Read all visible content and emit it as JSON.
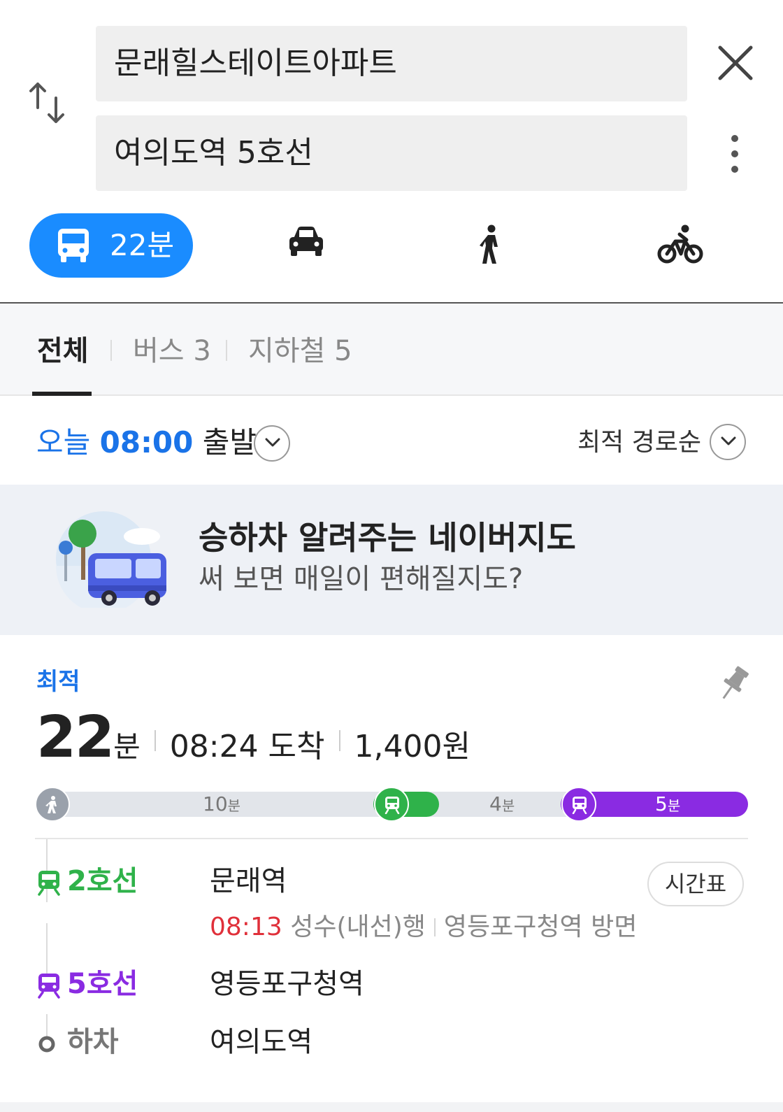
{
  "search": {
    "origin": "문래힐스테이트아파트",
    "destination": "여의도역 5호선"
  },
  "modes": {
    "transit_time": "22분",
    "active_color": "#1a8cff",
    "icons": [
      "bus-icon",
      "car-icon",
      "walk-icon",
      "bike-icon"
    ]
  },
  "tabs": {
    "all": "전체",
    "bus": "버스 3",
    "subway": "지하철 5"
  },
  "depart": {
    "today": "오늘",
    "time": "08:00",
    "label": "출발",
    "sort": "최적 경로순"
  },
  "banner": {
    "title": "승하차 알려주는 네이버지도",
    "subtitle": "써 보면 매일이 편해질지도?"
  },
  "route": {
    "badge": "최적",
    "duration_num": "22",
    "duration_unit": "분",
    "arrival": "08:24 도착",
    "fare": "1,400원",
    "timeline": {
      "walk_min": "10",
      "transfer_min": "4",
      "line5_min": "5",
      "unit": "분",
      "colors": {
        "walk": "#9aa1ab",
        "line2": "#2fb24a",
        "line5": "#8a2be2"
      }
    },
    "steps": [
      {
        "line": "2호선",
        "stop": "문래역"
      },
      {
        "line": "5호선",
        "stop": "영등포구청역"
      },
      {
        "line": "하차",
        "stop": "여의도역"
      }
    ],
    "detail": {
      "departure": "08:13",
      "direction": "성수(내선)행",
      "heading": "영등포구청역 방면"
    },
    "timetable": "시간표"
  }
}
